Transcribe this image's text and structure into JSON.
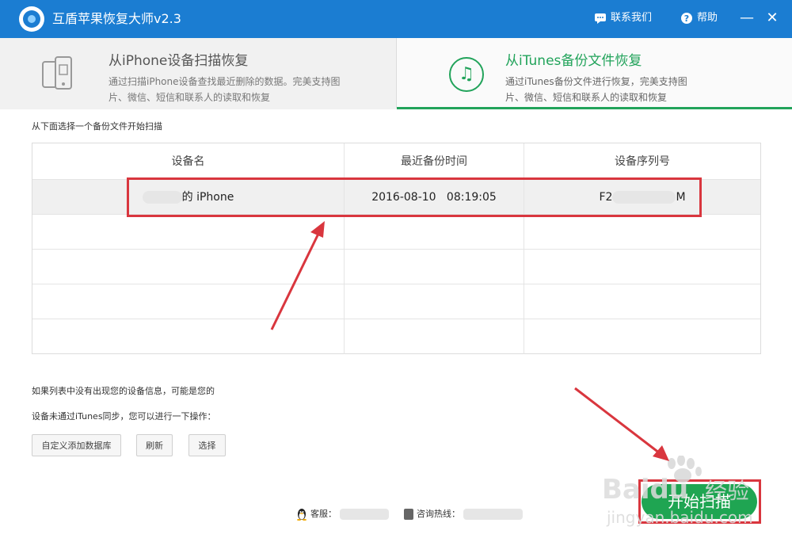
{
  "app": {
    "title": "互盾苹果恢复大师v2.3"
  },
  "titlebar": {
    "contact_label": "联系我们",
    "help_label": "帮助",
    "minimize": "—",
    "close": "✕"
  },
  "tabs": [
    {
      "title": "从iPhone设备扫描恢复",
      "desc": "通过扫描iPhone设备查找最近删除的数据。完美支持图片、微信、短信和联系人的读取和恢复",
      "active": false
    },
    {
      "title": "从iTunes备份文件恢复",
      "desc": "通过iTunes备份文件进行恢复，完美支持图片、微信、短信和联系人的读取和恢复",
      "active": true
    }
  ],
  "hint": "从下面选择一个备份文件开始扫描",
  "table": {
    "columns": [
      "设备名",
      "最近备份时间",
      "设备序列号"
    ],
    "rows": [
      {
        "device_name_suffix": "的 iPhone",
        "backup_time": "2016-08-10   08:19:05",
        "serial_prefix": "F2",
        "serial_suffix": "M"
      }
    ]
  },
  "notes": {
    "line1": "如果列表中没有出现您的设备信息，可能是您的",
    "line2": "设备未通过iTunes同步，您可以进行一下操作："
  },
  "buttons": {
    "custom_db": "自定义添加数据库",
    "refresh": "刷新",
    "select": "选择",
    "start_scan": "开始扫描"
  },
  "footer": {
    "service_label": "客服：",
    "hotline_label": "咨询热线："
  },
  "watermark": {
    "brand": "Baidu",
    "brand_cn": "经验",
    "url": "jingyan.baidu.com"
  },
  "colors": {
    "titlebar": "#1b7dd2",
    "accent_green": "#21a35a",
    "annotation_red": "#d9363e"
  }
}
